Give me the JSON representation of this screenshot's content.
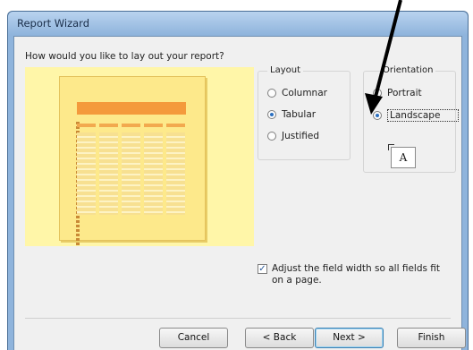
{
  "window": {
    "title": "Report Wizard"
  },
  "question": "How would you like to lay out your report?",
  "layout": {
    "label": "Layout",
    "options": [
      {
        "label": "Columnar",
        "selected": false
      },
      {
        "label": "Tabular",
        "selected": true
      },
      {
        "label": "Justified",
        "selected": false
      }
    ]
  },
  "orientation": {
    "label": "Orientation",
    "options": [
      {
        "label": "Portrait",
        "selected": false
      },
      {
        "label": "Landscape",
        "selected": true
      }
    ],
    "icon_letter": "A"
  },
  "adjust_checkbox": {
    "checked": true,
    "label": "Adjust the field width so all fields fit on a page."
  },
  "buttons": {
    "cancel": "Cancel",
    "back": "< Back",
    "next": "Next >",
    "finish": "Finish"
  }
}
